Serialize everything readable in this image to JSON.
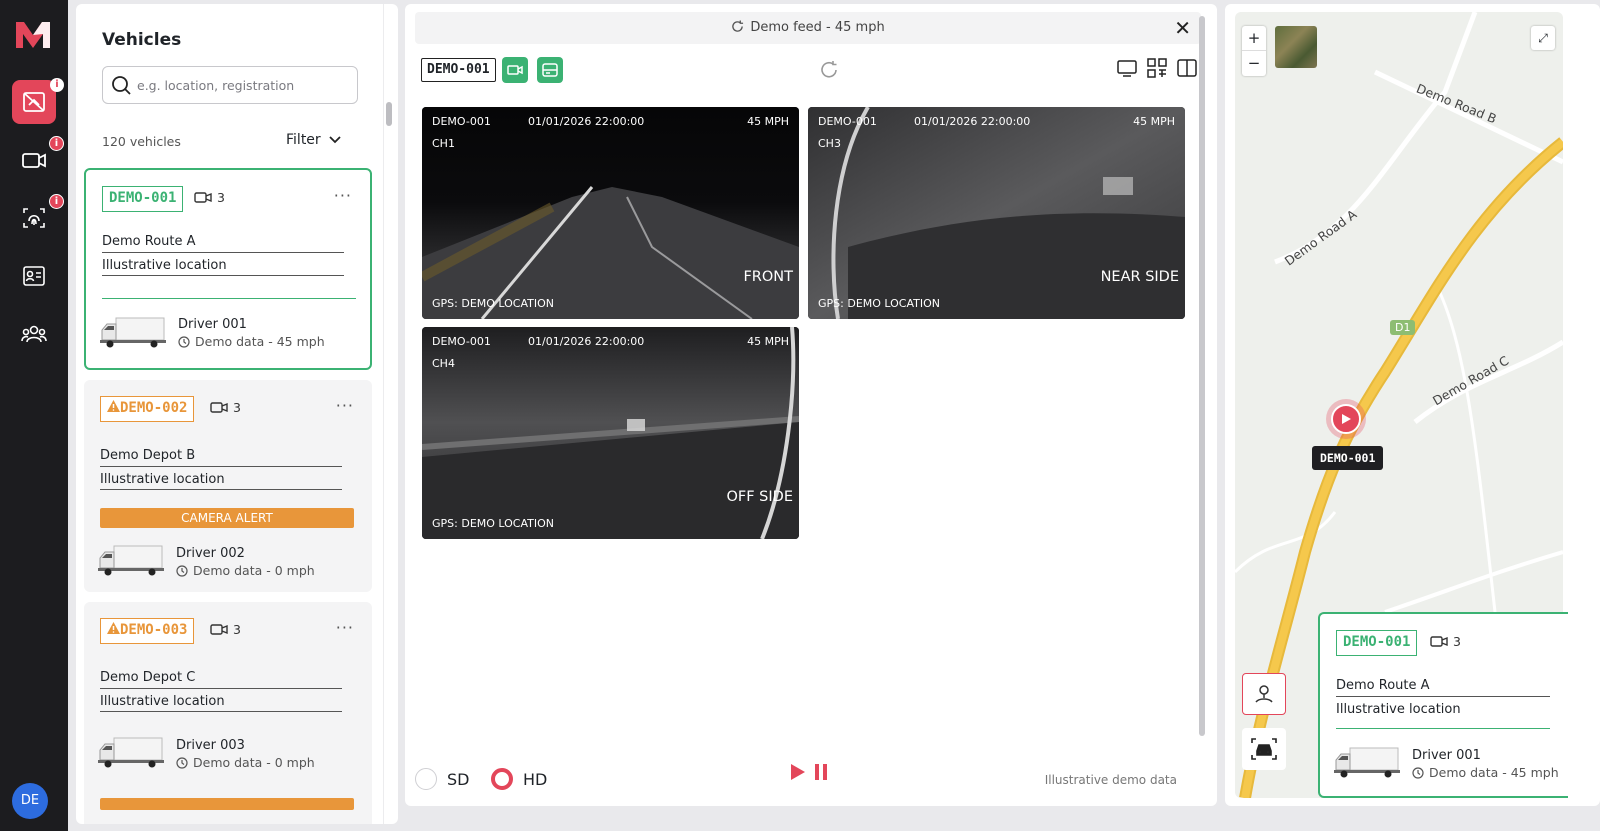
{
  "rail": {
    "avatar_initials": "DE",
    "badge_glyph": "i",
    "accent": "#e3465a",
    "items": [
      "alerts-icon",
      "camera-icon",
      "fingerprint-icon",
      "id-card-icon",
      "users-icon"
    ]
  },
  "vehicles": {
    "title": "Vehicles",
    "search_placeholder": "e.g. location, registration",
    "count": "120 vehicles",
    "filter_label": "Filter",
    "cards": [
      {
        "plate": "DEMO-001",
        "cams": "3",
        "route": "Demo Route A",
        "location": "Illustrative location",
        "alert": "",
        "driver": "Driver 001",
        "status": "Demo data - 45 mph",
        "selected": true
      },
      {
        "plate": "DEMO-002",
        "cams": "3",
        "route": "Demo Depot B",
        "location": "Illustrative location",
        "alert": "CAMERA ALERT",
        "driver": "Driver 002",
        "status": "Demo data - 0 mph",
        "selected": false
      },
      {
        "plate": "DEMO-003",
        "cams": "3",
        "route": "Demo Depot C",
        "location": "Illustrative location",
        "alert": "",
        "driver": "Driver 003",
        "status": "Demo data - 0 mph",
        "selected": false
      }
    ]
  },
  "video": {
    "header_title": "Demo feed - 45 mph",
    "plate": "DEMO-001",
    "feeds": [
      {
        "id": "DEMO-001",
        "time": "01/01/2026 22:00:00",
        "speed": "45 MPH",
        "channel": "CH1",
        "side": "FRONT",
        "gps": "GPS: DEMO LOCATION"
      },
      {
        "id": "DEMO-001",
        "time": "01/01/2026 22:00:00",
        "speed": "45 MPH",
        "channel": "CH3",
        "side": "NEAR SIDE",
        "gps": "GPS: DEMO LOCATION"
      },
      {
        "id": "DEMO-001",
        "time": "01/01/2026 22:00:00",
        "speed": "45 MPH",
        "channel": "CH4",
        "side": "OFF SIDE",
        "gps": "GPS: DEMO LOCATION"
      }
    ],
    "quality_sd": "SD",
    "quality_hd": "HD",
    "selected_quality": "HD",
    "note": "Illustrative demo data"
  },
  "map": {
    "zoom_in": "+",
    "zoom_out": "−",
    "roads": [
      "Demo Road B",
      "Demo Road A",
      "Demo Road C"
    ],
    "route_badge": "D1",
    "marker_label": "DEMO-001",
    "card": {
      "plate": "DEMO-001",
      "cams": "3",
      "route": "Demo Route A",
      "location": "Illustrative location",
      "driver": "Driver 001",
      "status": "Demo data - 45 mph"
    }
  },
  "colors": {
    "green": "#3bb273",
    "warning": "#e8963a",
    "red": "#e3465a",
    "road": "#f5c84c"
  }
}
